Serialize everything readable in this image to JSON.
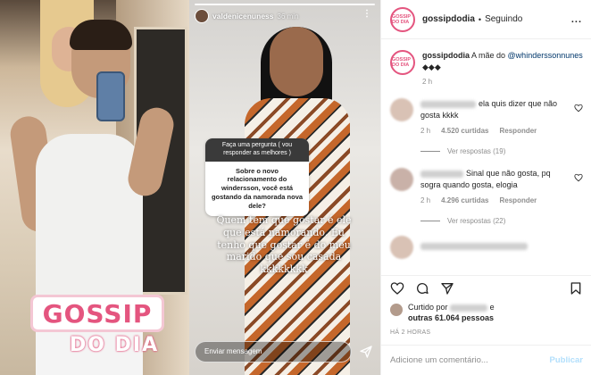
{
  "left_image": {
    "logo_top": "GOSSIP",
    "logo_bottom": "DO DIA"
  },
  "story": {
    "username": "valdenicenuness",
    "time": "36 min",
    "question_header": "Faça uma pergunta ( vou responder as melhores )",
    "question_body": "Sobre o novo relacionamento do windersson, você está gostando da namorada nova dele?",
    "answer_text": "Quem tem que gostar é ele que está namorando. Eu tenho que gostar é do meu marido que sou casada kkkkkkkk",
    "reply_placeholder": "Enviar mensagem"
  },
  "post": {
    "username": "gossipdodia",
    "separator": "•",
    "follow_status": "Seguindo",
    "more": "...",
    "avatar_text": "GOSSIP DO DIA",
    "caption": {
      "username": "gossipdodia",
      "text": " A mãe do ",
      "mention": "@whinderssonnunes",
      "emojis": " ◆◆◆",
      "time": "2 h"
    },
    "comments": [
      {
        "text": "ela quis dizer que não gosta kkkk",
        "time": "2 h",
        "likes": "4.520 curtidas",
        "reply": "Responder",
        "view_replies": "Ver respostas (19)"
      },
      {
        "text": "Sinal que não gosta, pq sogra quando gosta, elogia",
        "time": "2 h",
        "likes": "4.296 curtidas",
        "reply": "Responder",
        "view_replies": "Ver respostas (22)"
      }
    ],
    "liked_by_prefix": "Curtido por",
    "liked_by_suffix": "e",
    "liked_by_others": "outras 61.064 pessoas",
    "date": "HÁ 2 HORAS",
    "comment_placeholder": "Adicione um comentário...",
    "publish": "Publicar"
  },
  "colors": {
    "brand_pink": "#e4557f",
    "link_blue": "#00376b",
    "muted": "#8e8e8e",
    "publish_disabled": "#b2dffc"
  }
}
